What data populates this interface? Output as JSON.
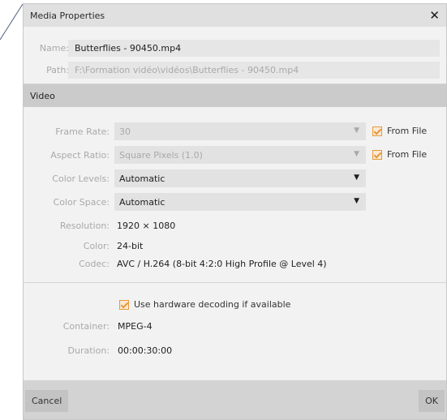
{
  "dialog": {
    "title": "Media Properties",
    "close_glyph": "✕"
  },
  "file": {
    "name_label": "Name:",
    "name_value": "Butterflies - 90450.mp4",
    "path_label": "Path:",
    "path_value": "F:\\Formation vidéo\\vidéos\\Butterflies - 90450.mp4"
  },
  "video": {
    "header": "Video",
    "frame_rate": {
      "label": "Frame Rate:",
      "value": "30",
      "from_file": "From File",
      "from_file_checked": true
    },
    "aspect_ratio": {
      "label": "Aspect Ratio:",
      "value": "Square Pixels (1.0)",
      "from_file": "From File",
      "from_file_checked": true
    },
    "color_levels": {
      "label": "Color Levels:",
      "value": "Automatic"
    },
    "color_space": {
      "label": "Color Space:",
      "value": "Automatic"
    },
    "resolution": {
      "label": "Resolution:",
      "value": "1920 × 1080"
    },
    "color": {
      "label": "Color:",
      "value": "24-bit"
    },
    "codec": {
      "label": "Codec:",
      "value": "AVC / H.264 (8-bit 4:2:0 High Profile @ Level 4)"
    }
  },
  "hardware": {
    "label": "Use hardware decoding if available",
    "checked": true
  },
  "container": {
    "label": "Container:",
    "value": "MPEG-4"
  },
  "duration": {
    "label": "Duration:",
    "value": "00:00:30:00"
  },
  "buttons": {
    "cancel": "Cancel",
    "ok": "OK"
  },
  "icons": {
    "dropdown": "triangle-down",
    "checkbox": "orange-check"
  },
  "colors": {
    "accent": "#e59a3a",
    "titlebar": "#e0e0e0",
    "section_header": "#cbcbcb",
    "footer": "#d3d3d3"
  }
}
